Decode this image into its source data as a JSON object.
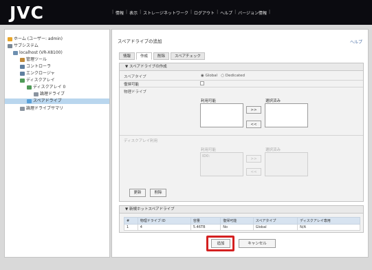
{
  "brand": {
    "logo": "JVC"
  },
  "top_nav": [
    "情報",
    "表示",
    "ストレージネットワーク",
    "ログアウト",
    "ヘルプ",
    "バージョン情報"
  ],
  "tree": [
    {
      "label": "ホーム (ユーザー: admin)",
      "icon": "home-icon"
    },
    {
      "label": "サブシステム",
      "icon": "subsystem-icon"
    },
    {
      "label": "localhost (VR-X8100)",
      "icon": "server-icon"
    },
    {
      "label": "管理ツール",
      "icon": "tools-icon"
    },
    {
      "label": "コントローラ",
      "icon": "controller-icon"
    },
    {
      "label": "エンクロージャ",
      "icon": "enclosure-icon"
    },
    {
      "label": "ディスクアレイ",
      "icon": "disk-array-icon"
    },
    {
      "label": "ディスクアレイ 0",
      "icon": "disk-array-icon"
    },
    {
      "label": "論理ドライブ",
      "icon": "logical-drive-icon"
    },
    {
      "label": "スペアドライブ",
      "icon": "spare-drive-icon"
    },
    {
      "label": "論理ドライブサマリ",
      "icon": "summary-icon"
    }
  ],
  "page": {
    "title": "スペアドライブの追加",
    "help": "ヘルプ"
  },
  "tabs": [
    "情報",
    "作成",
    "削除",
    "スペアチェック"
  ],
  "create_section": {
    "header": "スペアドライブの作成",
    "spare_type_label": "スペアタイプ",
    "opt_global": "Global",
    "opt_dedicated": "Dedicated",
    "revertible_label": "復帰可能",
    "physical_drive_label": "物理ドライブ",
    "available_label": "利用可能",
    "selected_label": "選択済み",
    "disk_array_label": "ディスクアレイ利用",
    "disk_available_label": "利用可能",
    "disk_selected_label": "選択済み",
    "disk_available_value": "ID0:",
    "add_btn": ">>",
    "remove_btn": "<<",
    "update_btn": "更新",
    "delete_btn": "削除"
  },
  "new_spare_section": {
    "header": "新規ホットスペアドライブ",
    "columns": [
      "#",
      "物理ドライブ ID",
      "容量",
      "復帰可能",
      "スペアタイプ",
      "ディスクアレイ専用"
    ],
    "rows": [
      [
        "1",
        "4",
        "5.46TB",
        "No",
        "Global",
        "N/A"
      ]
    ]
  },
  "actions": {
    "submit": "追加",
    "cancel": "キャンセル"
  },
  "colors": {
    "topbar": "#0b0b10",
    "logo_accent": "#d90000",
    "highlight": "#d42020",
    "selected_tree": "#b9d6ee"
  }
}
